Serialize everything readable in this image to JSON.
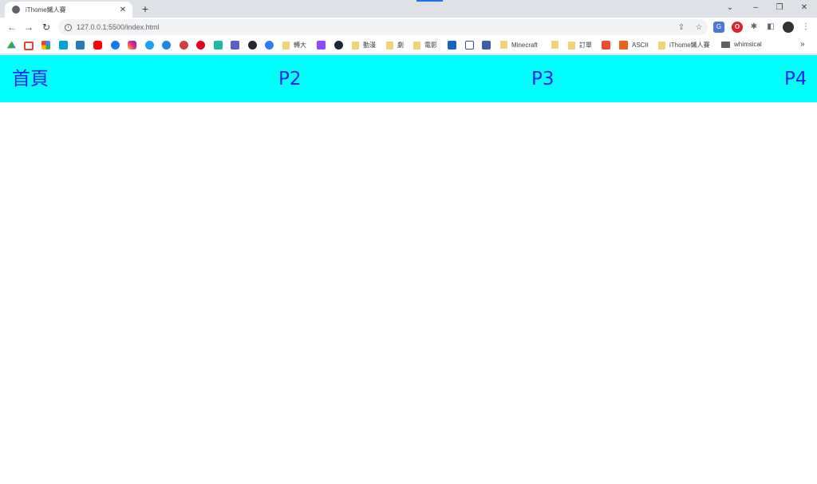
{
  "browser": {
    "tab": {
      "title": "iThome鐵人賽",
      "close_glyph": "✕"
    },
    "new_tab_glyph": "+",
    "window_controls": {
      "dropdown": "⌄",
      "minimize": "–",
      "restore": "❐",
      "close": "✕"
    },
    "nav": {
      "back": "←",
      "forward": "→",
      "reload": "↻"
    },
    "address": {
      "url": "127.0.0.1:5500/index.html"
    },
    "bookmarks": {
      "folders": [
        {
          "label": "轉大"
        },
        {
          "label": "動漫"
        },
        {
          "label": "劇"
        },
        {
          "label": "電影"
        },
        {
          "label": "Minecraft"
        },
        {
          "label": ""
        },
        {
          "label": "訂單"
        },
        {
          "label": "ASCII"
        },
        {
          "label": "iThome鐵人賽"
        },
        {
          "label": "whimsical"
        }
      ],
      "more_glyph": "»"
    }
  },
  "page": {
    "nav_background": "#00ffff",
    "link_color": "#2323ee",
    "links": [
      {
        "label": "首頁"
      },
      {
        "label": "P2"
      },
      {
        "label": "P3"
      },
      {
        "label": "P4"
      }
    ]
  }
}
